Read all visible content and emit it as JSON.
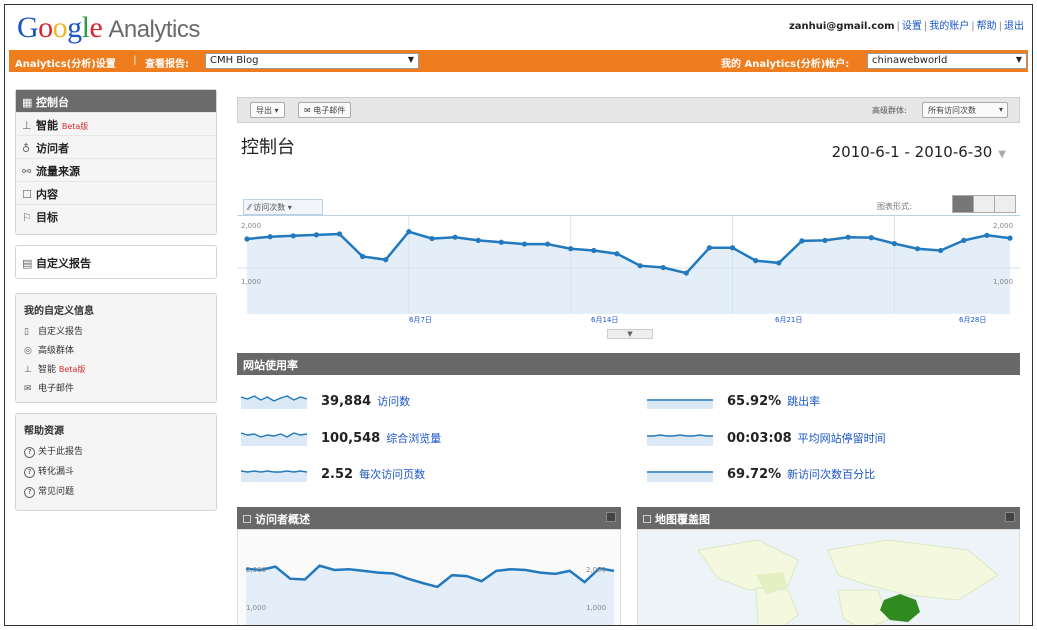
{
  "header": {
    "logo_google": [
      "G",
      "o",
      "o",
      "g",
      "l",
      "e"
    ],
    "logo_product": "Analytics",
    "user_email": "zanhui@gmail.com",
    "links": [
      "设置",
      "我的账户",
      "帮助",
      "退出"
    ]
  },
  "orange_bar": {
    "settings_link": "Analytics(分析)设置",
    "view_reports_label": "查看报告:",
    "profile_value": "CMH Blog",
    "my_accounts_label": "我的 Analytics(分析)帐户:",
    "account_value": "chinawebworld"
  },
  "sidebar": {
    "nav": [
      {
        "label": "控制台",
        "icon": "grid-icon",
        "active": true
      },
      {
        "label": "智能",
        "icon": "chart-icon",
        "tag": "Beta版"
      },
      {
        "label": "访问者",
        "icon": "person-icon"
      },
      {
        "label": "流量来源",
        "icon": "traffic-icon"
      },
      {
        "label": "内容",
        "icon": "document-icon"
      },
      {
        "label": "目标",
        "icon": "flag-icon"
      }
    ],
    "custom_reports": "自定义报告",
    "my_custom": {
      "title": "我的自定义信息",
      "items": [
        {
          "label": "自定义报告",
          "icon": "document-icon"
        },
        {
          "label": "高级群体",
          "icon": "segment-icon"
        },
        {
          "label": "智能",
          "icon": "chart-icon",
          "tag": "Beta版"
        },
        {
          "label": "电子邮件",
          "icon": "mail-icon"
        }
      ]
    },
    "help": {
      "title": "帮助资源",
      "items": [
        "关于此报告",
        "转化漏斗",
        "常见问题"
      ]
    }
  },
  "toolbar": {
    "export_label": "导出",
    "email_label": "电子邮件",
    "segment_label": "高级群体:",
    "segment_value": "所有访问次数"
  },
  "page": {
    "title": "控制台",
    "date_range": "2010-6-1 - 2010-6-30"
  },
  "chart": {
    "tab_label": "访问次数",
    "view_label": "图表形式:",
    "y_top_left": "2,000",
    "y_mid_left": "1,000",
    "y_top_right": "2,000",
    "y_mid_right": "1,000",
    "x_labels": [
      "6月7日",
      "6月14日",
      "6月21日",
      "6月28日"
    ]
  },
  "chart_data": {
    "type": "area",
    "series": [
      {
        "values": [
          1630,
          1680,
          1700,
          1720,
          1740,
          1250,
          1180,
          1790,
          1640,
          1670,
          1600,
          1560,
          1520,
          1520,
          1420,
          1380,
          1310,
          1050,
          1010,
          890,
          1440,
          1440,
          1160,
          1110,
          1590,
          1600,
          1670,
          1660,
          1530,
          1420,
          1380,
          1600,
          1710,
          1650
        ]
      }
    ],
    "ylim": [
      0,
      2000
    ],
    "grid": true
  },
  "site_usage": {
    "title": "网站使用率",
    "metrics": [
      {
        "value": "39,884",
        "label": "访问数"
      },
      {
        "value": "100,548",
        "label": "综合浏览量"
      },
      {
        "value": "2.52",
        "label": "每次访问页数"
      },
      {
        "value": "65.92%",
        "label": "跳出率"
      },
      {
        "value": "00:03:08",
        "label": "平均网站停留时间"
      },
      {
        "value": "69.72%",
        "label": "新访问次数百分比"
      }
    ]
  },
  "visitors_overview": {
    "title": "访问者概述",
    "y_top_left": "2,000",
    "y_mid_left": "1,000",
    "y_top_right": "2,000",
    "y_mid_right": "1,000",
    "values": [
      1650,
      1620,
      1700,
      1420,
      1400,
      1720,
      1620,
      1640,
      1600,
      1560,
      1540,
      1420,
      1320,
      1230,
      1500,
      1480,
      1360,
      1600,
      1640,
      1620,
      1560,
      1530,
      1600,
      1340,
      1660,
      1600
    ]
  },
  "map_overlay": {
    "title": "地图覆盖图"
  },
  "colors": {
    "orange": "#f07d1d",
    "dark_bar": "#686868",
    "line": "#2279bd",
    "area": "#e4eef8",
    "link": "#1a55c7",
    "china": "#2f8a1f"
  }
}
